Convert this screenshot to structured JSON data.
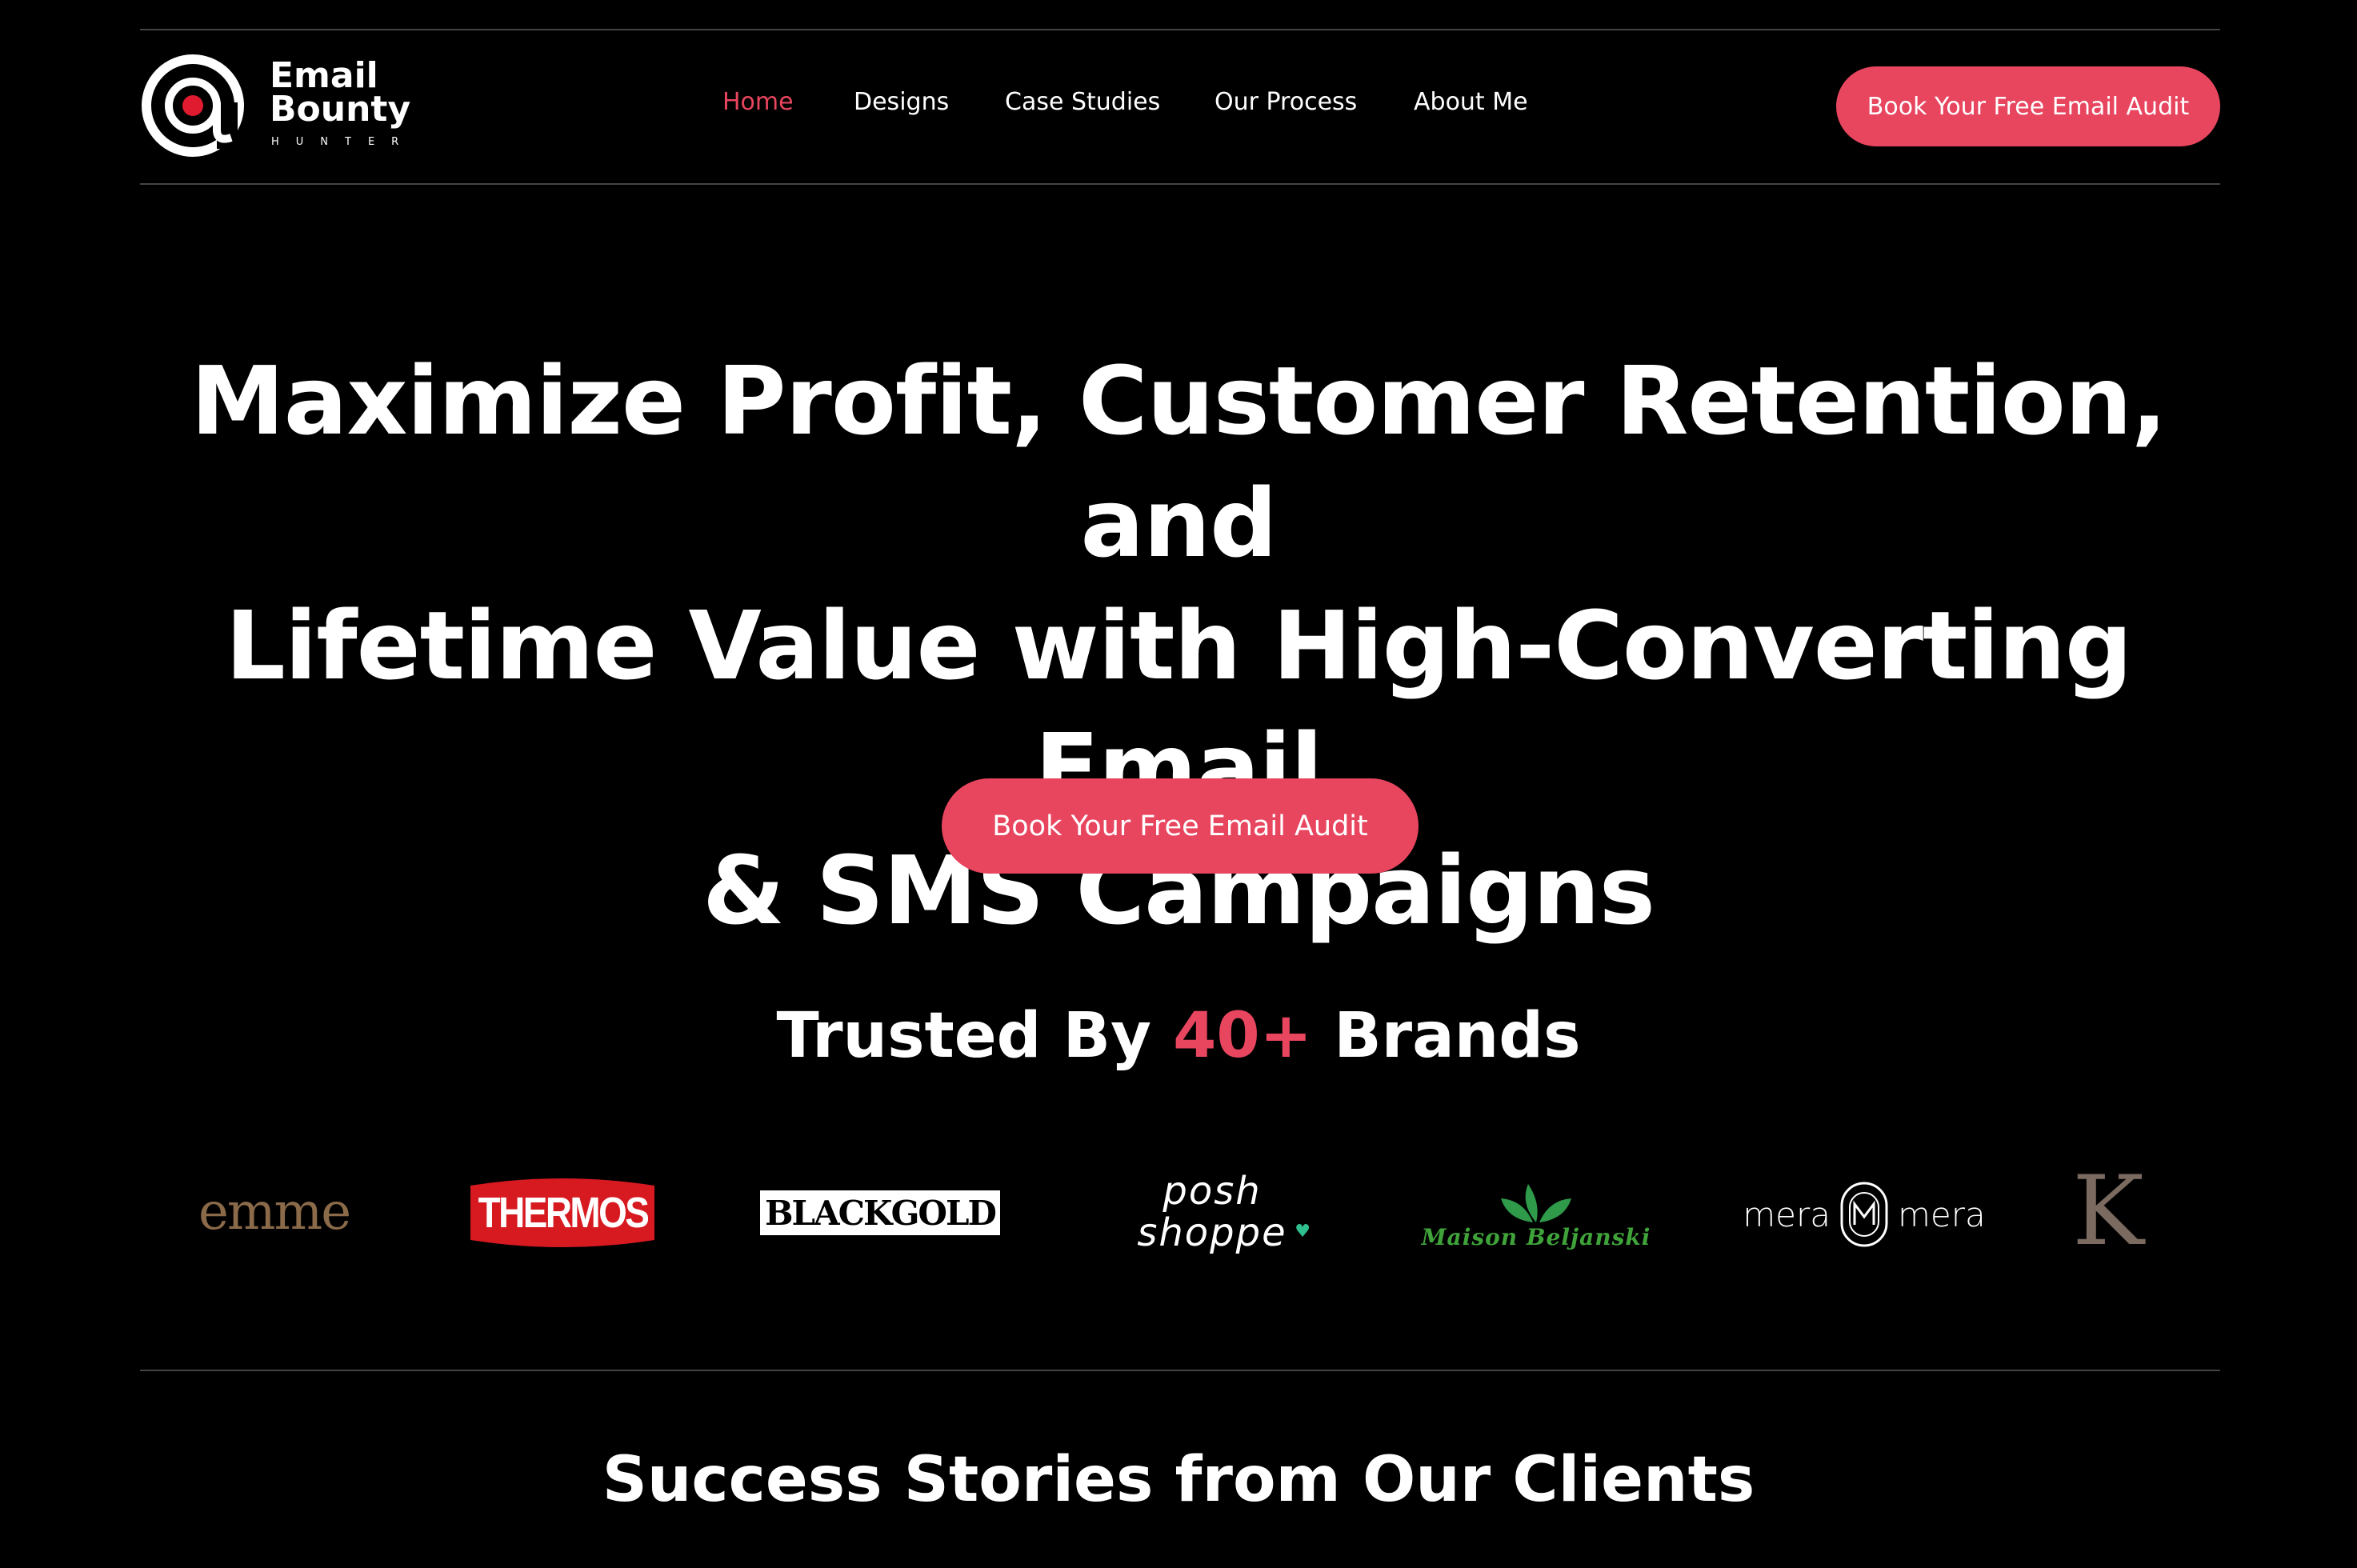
{
  "header": {
    "logo_text_line1": "Email",
    "logo_text_line2": "Bounty",
    "logo_subtext": "HUNTER",
    "nav": [
      {
        "label": "Home",
        "active": true
      },
      {
        "label": "Designs",
        "active": false
      },
      {
        "label": "Case Studies",
        "active": false
      },
      {
        "label": "Our Process",
        "active": false
      },
      {
        "label": "About Me",
        "active": false
      }
    ],
    "cta_label": "Book Your Free Email Audit"
  },
  "hero": {
    "title_line1": "Maximize Profit, Customer Retention, and",
    "title_line2": "Lifetime Value with High-Converting Email",
    "title_line3": "& SMS Campaigns",
    "cta_label": "Book Your Free Email Audit"
  },
  "trusted": {
    "prefix": "Trusted By ",
    "count": "40+",
    "suffix": " Brands"
  },
  "brands": [
    {
      "name": "emme",
      "icon": "emme-logo"
    },
    {
      "name": "THERMOS",
      "icon": "thermos-logo"
    },
    {
      "name": "BLACKGOLD",
      "icon": "blackgold-logo"
    },
    {
      "name": "posh shoppe",
      "icon": "posh-shoppe-logo"
    },
    {
      "name": "Maison Beljanski",
      "icon": "maison-beljanski-logo"
    },
    {
      "name_left": "mera",
      "name_right": "mera",
      "icon": "mera-mera-logo"
    },
    {
      "name": "K",
      "icon": "k-logo"
    }
  ],
  "success": {
    "title": "Success Stories from Our Clients"
  },
  "colors": {
    "accent": "#e8455f",
    "background": "#000000",
    "text": "#ffffff"
  }
}
